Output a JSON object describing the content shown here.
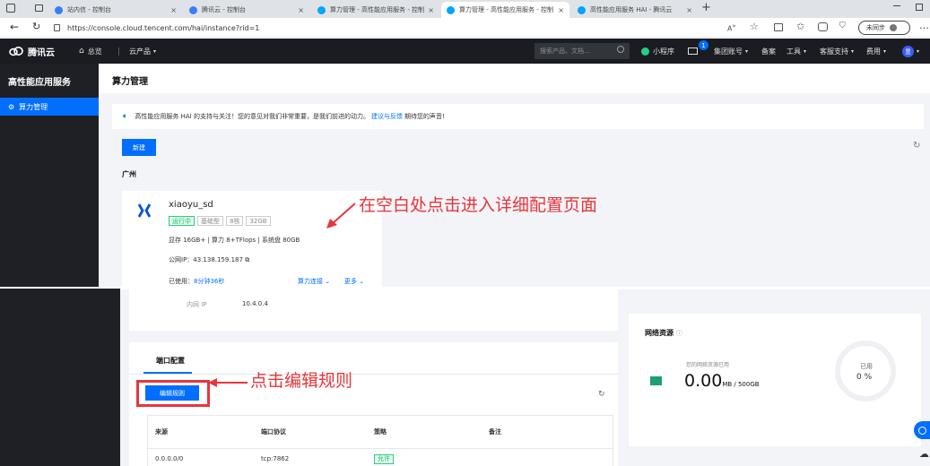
{
  "browser": {
    "tabs": [
      {
        "title": "站内信 - 控制台",
        "active": false
      },
      {
        "title": "腾讯云 - 控制台",
        "active": false
      },
      {
        "title": "算力管理 - 高性能应用服务 - 控制",
        "active": false
      },
      {
        "title": "算力管理 - 高性能应用服务 - 控制",
        "active": true
      },
      {
        "title": "高性能应用服务 HAI - 腾讯云",
        "active": false
      }
    ],
    "url": "https://console.cloud.tencent.com/hai/instance?rid=1",
    "profile_label": "未同步"
  },
  "header": {
    "logo": "腾讯云",
    "home": "总览",
    "products": "云产品",
    "search_placeholder": "搜索产品、文档...",
    "mini_program": "小程序",
    "message_count": "1",
    "group_account": "集团账号",
    "filing": "备案",
    "tools": "工具",
    "support": "客服支持",
    "billing": "费用",
    "avatar": "置"
  },
  "sidebar": {
    "title": "高性能应用服务",
    "items": [
      {
        "label": "算力管理"
      }
    ]
  },
  "main": {
    "title": "算力管理",
    "notice": "高性能应用服务 HAI 的支持与关注！您的意见对我们非常重要，是我们前进的动力。",
    "notice_link": "建议与反馈",
    "notice_tail": "期待您的声音!",
    "new_button": "新建",
    "region": "广州",
    "instance": {
      "name": "xiaoyu_sd",
      "status": "运行中",
      "tier": "基础型",
      "cores": "8核",
      "memory": "32GB",
      "specs": "显存 16GB+ | 算力 8+TFlops | 系统盘 80GB",
      "ip_label": "公网IP：",
      "ip": "43.138.159.187",
      "used_label": "已使用：",
      "used_value": "8分钟36秒",
      "connect": "算力连接",
      "more": "更多"
    },
    "annotation_top": "在空白处点击进入详细配置页面"
  },
  "detail": {
    "private_ip_label": "内网 IP",
    "private_ip": "10.4.0.4",
    "port_tab": "端口配置",
    "edit_rule_button": "编辑规则",
    "annotation_bottom": "点击编辑规则",
    "table": {
      "headers": [
        "来源",
        "端口协议",
        "策略",
        "备注"
      ],
      "rows": [
        {
          "source": "0.0.0.0/0",
          "protocol": "tcp:7862",
          "policy": "允许",
          "remark": ""
        }
      ]
    },
    "network": {
      "title": "网络资源",
      "used_label": "您的网络资源已用",
      "value": "0.00",
      "unit": "MB / 500GB",
      "ring_label": "已用",
      "ring_value": "0 %"
    }
  },
  "colors": {
    "accent": "#006eff",
    "annotation": "#e8353b",
    "success": "#0abf5b",
    "header_bg": "#1b1c21",
    "sidebar_bg": "#1f2026"
  }
}
